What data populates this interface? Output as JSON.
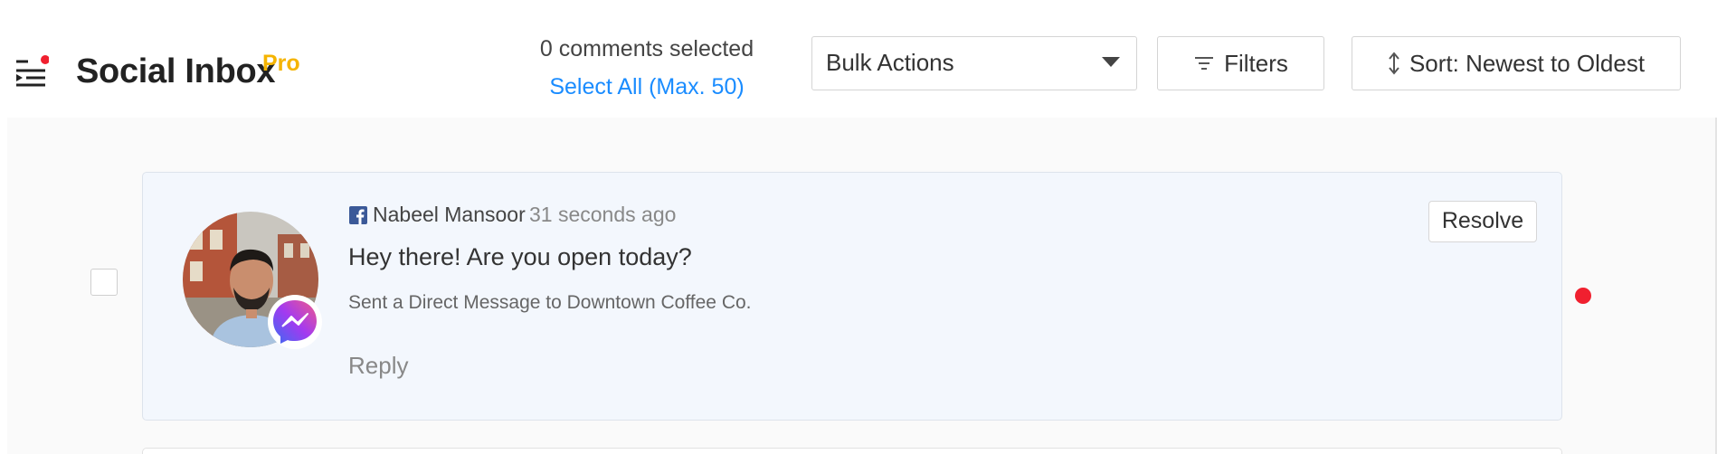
{
  "header": {
    "menu_icon": "menu-collapse-icon",
    "app_title": "Social Inbox",
    "app_badge": "Pro",
    "badge_color": "#f5b400",
    "selection_count": "0 comments selected",
    "select_all": "Select All (Max. 50)",
    "bulk_actions": {
      "selected": "Bulk Actions",
      "icon": "caret-down-icon"
    },
    "filters": {
      "label": "Filters",
      "icon": "filter-icon"
    },
    "sort": {
      "label": "Sort: Newest to Oldest",
      "icon": "sort-arrows-icon"
    }
  },
  "colors": {
    "link": "#1a8cff",
    "card_bg": "#f3f7fd",
    "unread_dot": "#f0202f",
    "facebook": "#3b5998"
  },
  "comments": [
    {
      "network_icon": "facebook-icon",
      "channel_icon": "messenger-icon",
      "author": "Nabeel Mansoor",
      "time": "31 seconds ago",
      "message": "Hey there! Are you open today?",
      "context": "Sent a Direct Message to Downtown Coffee Co.",
      "reply_label": "Reply",
      "resolve_label": "Resolve",
      "selected": false,
      "unread": true
    }
  ]
}
